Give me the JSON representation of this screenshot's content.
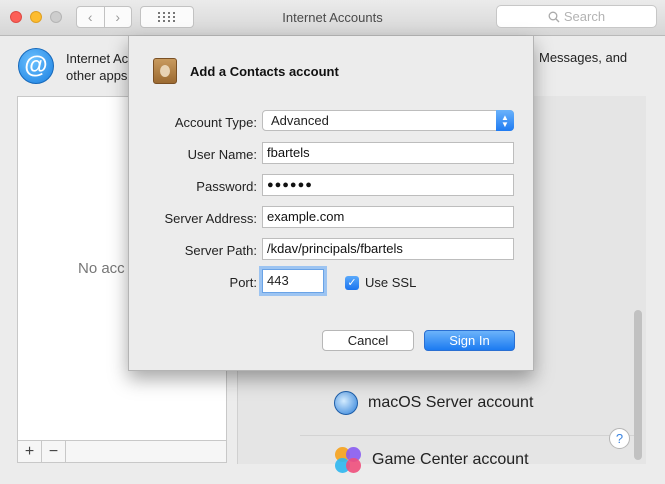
{
  "window": {
    "title": "Internet Accounts",
    "search_placeholder": "Search",
    "back_glyph": "‹",
    "forward_glyph": "›"
  },
  "header": {
    "text_line1": "Internet Ac",
    "text_line2": "other apps",
    "text_right": "Messages, and",
    "icon": "at-icon",
    "icon_glyph": "@"
  },
  "left_panel": {
    "empty_text": "No acc",
    "add_label": "+",
    "remove_label": "−"
  },
  "services": [
    {
      "label": "macOS Server account",
      "icon": "macos-server-icon"
    },
    {
      "label": "Game Center account",
      "icon": "game-center-icon"
    }
  ],
  "help_label": "?",
  "sheet": {
    "title": "Add a Contacts account",
    "icon": "contacts-icon",
    "fields": {
      "account_type": {
        "label": "Account Type:",
        "value": "Advanced"
      },
      "user_name": {
        "label": "User Name:",
        "value": "fbartels"
      },
      "password": {
        "label": "Password:",
        "value": "●●●●●●"
      },
      "server_address": {
        "label": "Server Address:",
        "value": "example.com"
      },
      "server_path": {
        "label": "Server Path:",
        "value": "/kdav/principals/fbartels"
      },
      "port": {
        "label": "Port:",
        "value": "443"
      }
    },
    "use_ssl": {
      "label": "Use SSL",
      "checked": true,
      "check_glyph": "✓"
    },
    "cancel_label": "Cancel",
    "sign_in_label": "Sign In"
  },
  "colors": {
    "accent": "#1c7af1",
    "close": "#fc5f57",
    "minimize": "#fdbc2e"
  }
}
